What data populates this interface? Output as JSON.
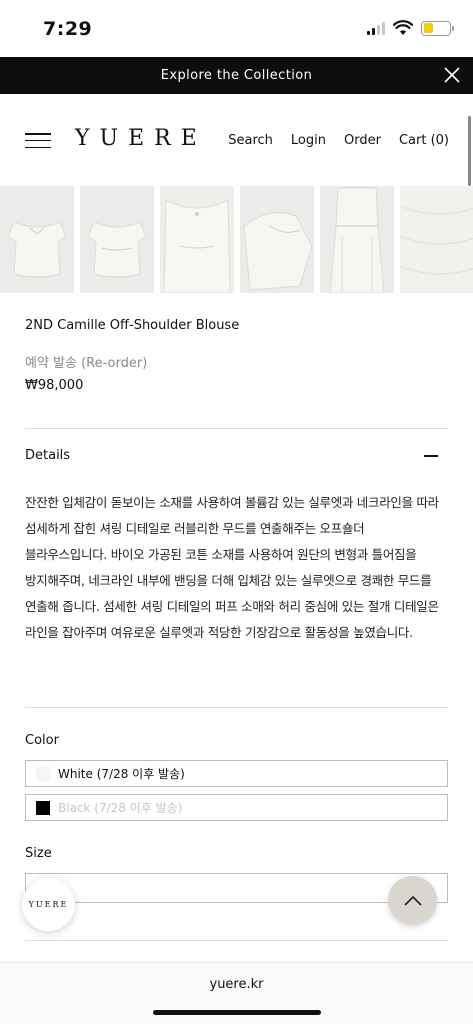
{
  "status_bar": {
    "time": "7:29"
  },
  "announcement": {
    "text": "Explore the Collection"
  },
  "header": {
    "logo": "YUERE",
    "nav": [
      "Search",
      "Login",
      "Order",
      "Cart (0)"
    ]
  },
  "product": {
    "name": "2ND Camille Off-Shoulder Blouse",
    "reorder_label": "예약 발송 (Re-order)",
    "price": "₩98,000"
  },
  "details": {
    "label": "Details",
    "text": "잔잔한 입체감이 돋보이는 소재를 사용하여 볼륨감 있는 실루엣과 네크라인을 따라 섬세하게 잡힌 셔링 디테일로 러블리한 무드를 연출해주는 오프숄더 블라우스입니다. 바이오 가공된 코튼 소재를 사용하여 원단의 변형과 틀어짐을 방지해주며, 네크라인 내부에 밴딩을 더해 입체감 있는 실루엣으로 경쾌한 무드를 연출해 줍니다. 섬세한 셔링 디테일의 퍼프 소매와 허리 중심에 있는 절개 디테일은 라인을 잡아주며 여유로운 실루엣과 적당한 기장감으로 활동성을 높였습니다."
  },
  "color": {
    "label": "Color",
    "options": [
      {
        "text": "White (7/28 이후 발송)",
        "swatch": "#f5f5f3",
        "disabled": false
      },
      {
        "text": "Black (7/28 이후 발송)",
        "swatch": "#000000",
        "disabled": true
      }
    ]
  },
  "size": {
    "label": "Size"
  },
  "floating": {
    "logo": "YUERE"
  },
  "browser": {
    "url": "yuere.kr"
  }
}
